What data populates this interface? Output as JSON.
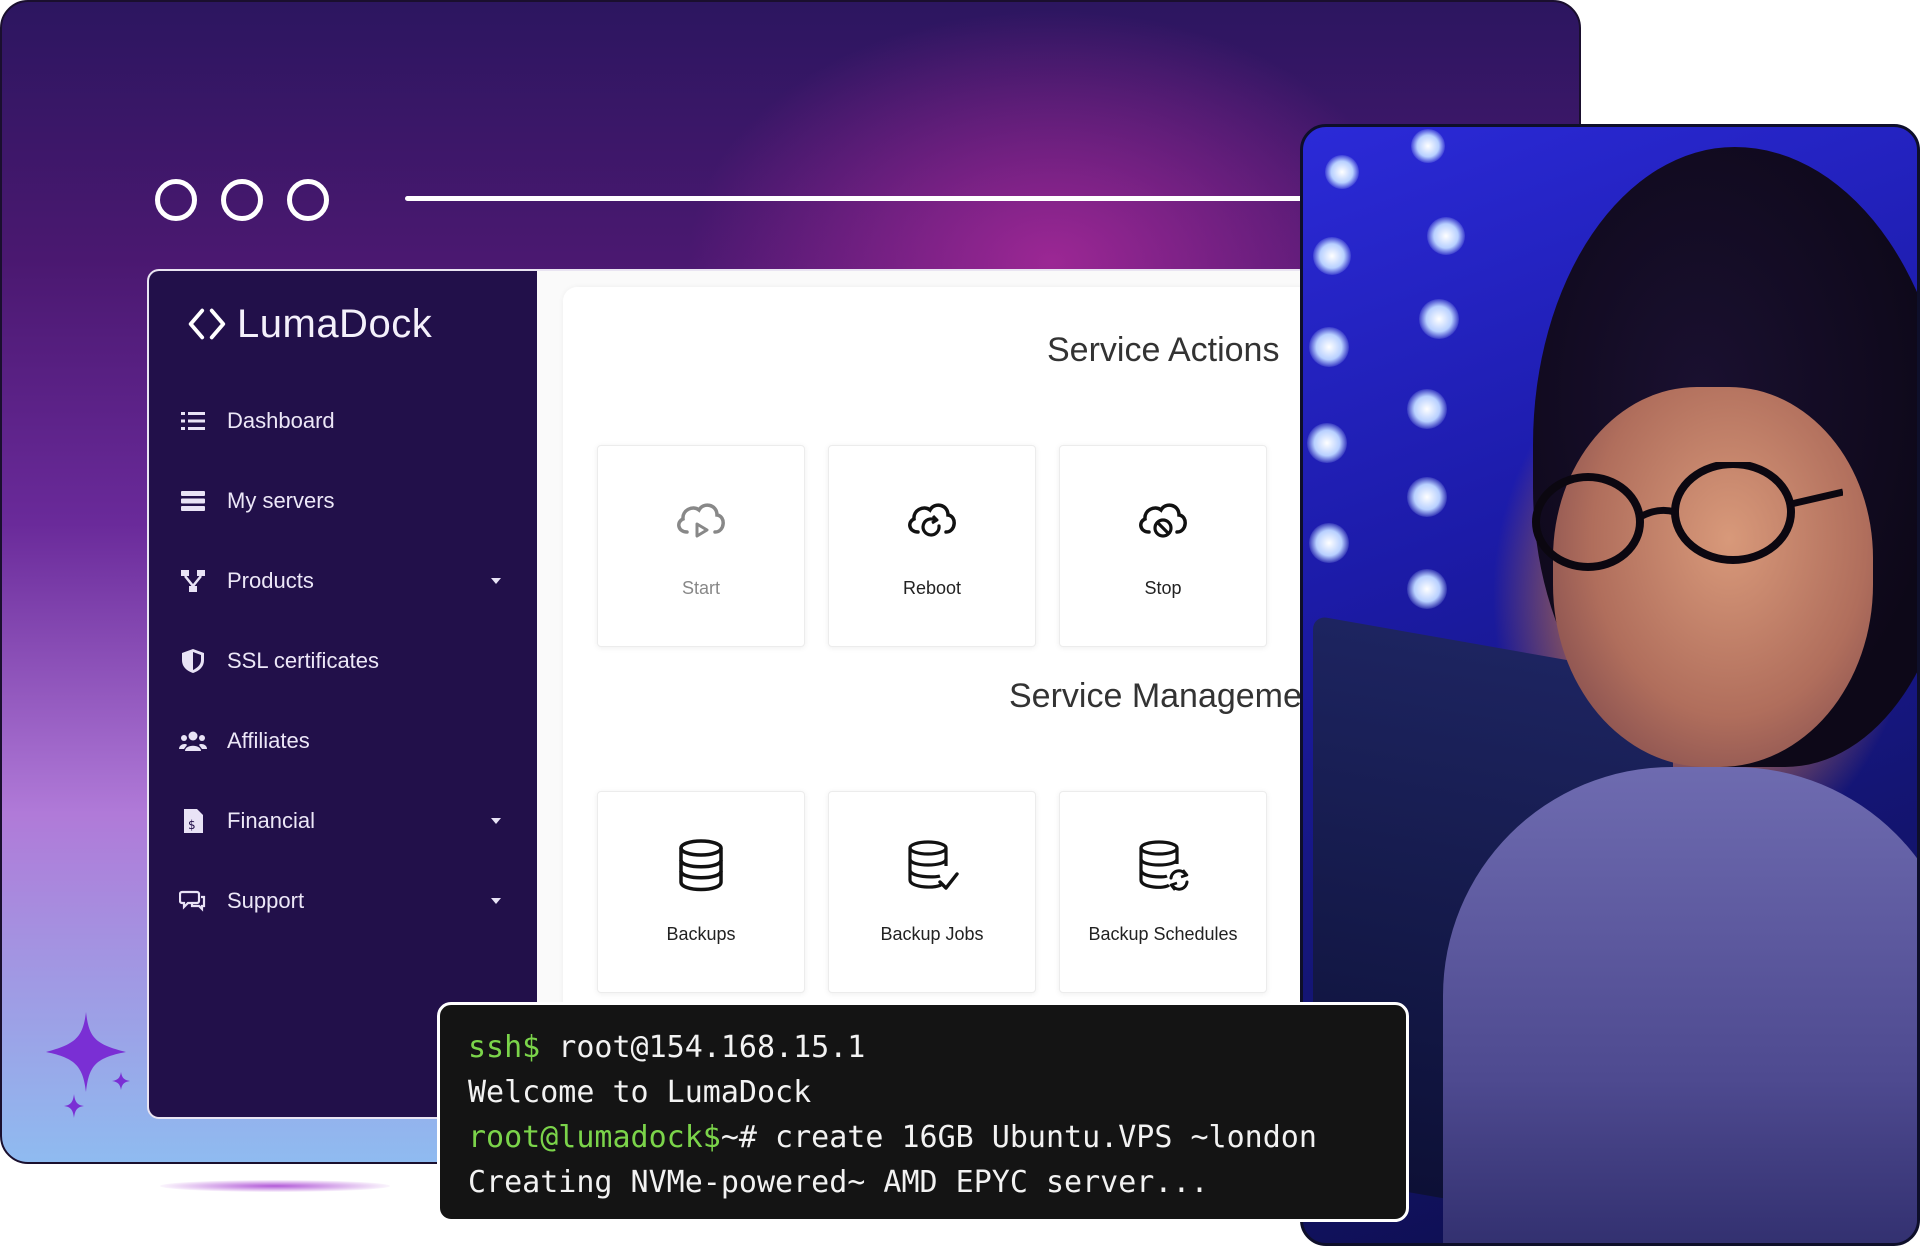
{
  "brand": {
    "name": "LumaDock"
  },
  "sidebar": {
    "items": [
      {
        "label": "Dashboard",
        "icon": "list-icon",
        "has_caret": false
      },
      {
        "label": "My servers",
        "icon": "server-icon",
        "has_caret": false
      },
      {
        "label": "Products",
        "icon": "sitemap-icon",
        "has_caret": true
      },
      {
        "label": "SSL certificates",
        "icon": "shield-icon",
        "has_caret": false
      },
      {
        "label": "Affiliates",
        "icon": "users-icon",
        "has_caret": false
      },
      {
        "label": "Financial",
        "icon": "invoice-icon",
        "has_caret": true
      },
      {
        "label": "Support",
        "icon": "chat-icon",
        "has_caret": true
      }
    ]
  },
  "service_actions": {
    "title": "Service Actions",
    "cards": [
      {
        "label": "Start",
        "icon": "cloud-play-icon",
        "dimmed": true
      },
      {
        "label": "Reboot",
        "icon": "cloud-refresh-icon",
        "dimmed": false
      },
      {
        "label": "Stop",
        "icon": "cloud-stop-icon",
        "dimmed": false
      }
    ]
  },
  "service_management": {
    "title": "Service Manageme",
    "cards": [
      {
        "label": "Backups",
        "icon": "database-icon"
      },
      {
        "label": "Backup Jobs",
        "icon": "database-check-icon"
      },
      {
        "label": "Backup Schedules",
        "icon": "database-sync-icon"
      }
    ]
  },
  "terminal": {
    "line1_prompt": "ssh$",
    "line1_cmd": " root@154.168.15.1",
    "line2": "Welcome to LumaDock",
    "line3_prompt": "root@lumadock$",
    "line3_cmd": "~# create 16GB Ubuntu.VPS ~london",
    "line4": "Creating NVMe-powered~ AMD EPYC server..."
  },
  "colors": {
    "sidebar_bg": "#22104a",
    "terminal_prompt": "#7bd44a",
    "accent_purple": "#6a2a9a"
  }
}
